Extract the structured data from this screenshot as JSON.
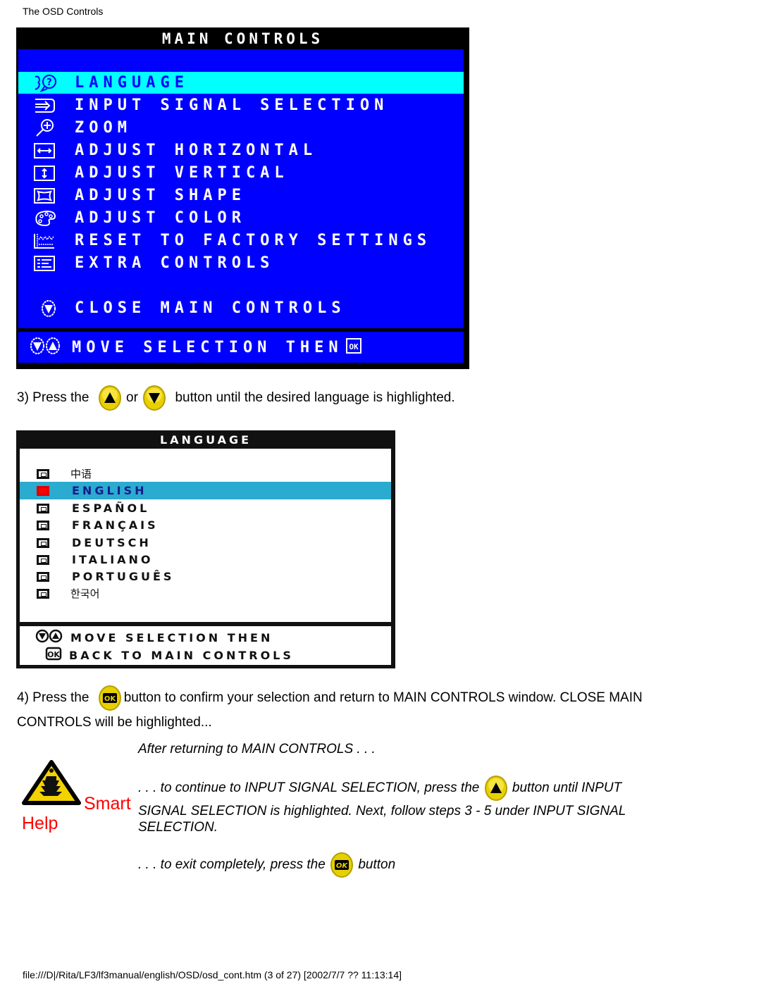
{
  "page_header": "The OSD Controls",
  "main_osd": {
    "title": "MAIN CONTROLS",
    "items": [
      {
        "label": "LANGUAGE",
        "icon": "language-icon",
        "selected": true
      },
      {
        "label": "INPUT SIGNAL SELECTION",
        "icon": "input-signal-icon",
        "selected": false
      },
      {
        "label": "ZOOM",
        "icon": "zoom-icon",
        "selected": false
      },
      {
        "label": "ADJUST HORIZONTAL",
        "icon": "horizontal-arrows-icon",
        "selected": false
      },
      {
        "label": "ADJUST VERTICAL",
        "icon": "vertical-arrows-icon",
        "selected": false
      },
      {
        "label": "ADJUST SHAPE",
        "icon": "shape-icon",
        "selected": false
      },
      {
        "label": "ADJUST COLOR",
        "icon": "palette-icon",
        "selected": false
      },
      {
        "label": "RESET TO FACTORY SETTINGS",
        "icon": "factory-icon",
        "selected": false
      },
      {
        "label": "EXTRA CONTROLS",
        "icon": "list-icon",
        "selected": false
      }
    ],
    "close_label": "CLOSE MAIN CONTROLS",
    "footer_label": "MOVE SELECTION THEN",
    "ok_glyph": "OK",
    "colors": {
      "background": "#0000ff",
      "highlight": "#00ffff",
      "frame": "#000000",
      "text": "#ffffff"
    }
  },
  "step3": {
    "prefix": "3) Press the",
    "or": "or",
    "suffix": "button until the desired language is highlighted."
  },
  "language_osd": {
    "title": "LANGUAGE",
    "items": [
      {
        "label": "中语",
        "selected": false
      },
      {
        "label": "ENGLISH",
        "selected": true
      },
      {
        "label": "ESPAÑOL",
        "selected": false
      },
      {
        "label": "FRANÇAIS",
        "selected": false
      },
      {
        "label": "DEUTSCH",
        "selected": false
      },
      {
        "label": "ITALIANO",
        "selected": false
      },
      {
        "label": "PORTUGUÊS",
        "selected": false
      },
      {
        "label": "한국어",
        "selected": false
      }
    ],
    "footer_line1": "MOVE SELECTION THEN",
    "footer_line2": "BACK TO MAIN CONTROLS",
    "colors": {
      "highlight": "#2aabcf",
      "selected_box": "#ff0000"
    }
  },
  "step4": {
    "prefix": "4) Press the",
    "suffix": "button to confirm your selection and return to MAIN CONTROLS window. CLOSE MAIN",
    "line2": "CONTROLS will be highlighted..."
  },
  "smart_help": {
    "word1": "Smart",
    "word2": "Help",
    "after": "After returning to MAIN CONTROLS . . .",
    "continue_prefix": ". . . to continue to INPUT SIGNAL SELECTION, press the",
    "continue_suffix": "button until INPUT",
    "continue_line2": "SIGNAL SELECTION is highlighted. Next, follow steps 3 - 5 under INPUT SIGNAL",
    "continue_line3": "SELECTION.",
    "exit_prefix": ". . . to exit completely, press the",
    "exit_suffix": "button"
  },
  "footer": "file:///D|/Rita/LF3/lf3manual/english/OSD/osd_cont.htm (3 of 27) [2002/7/7 ?? 11:13:14]"
}
